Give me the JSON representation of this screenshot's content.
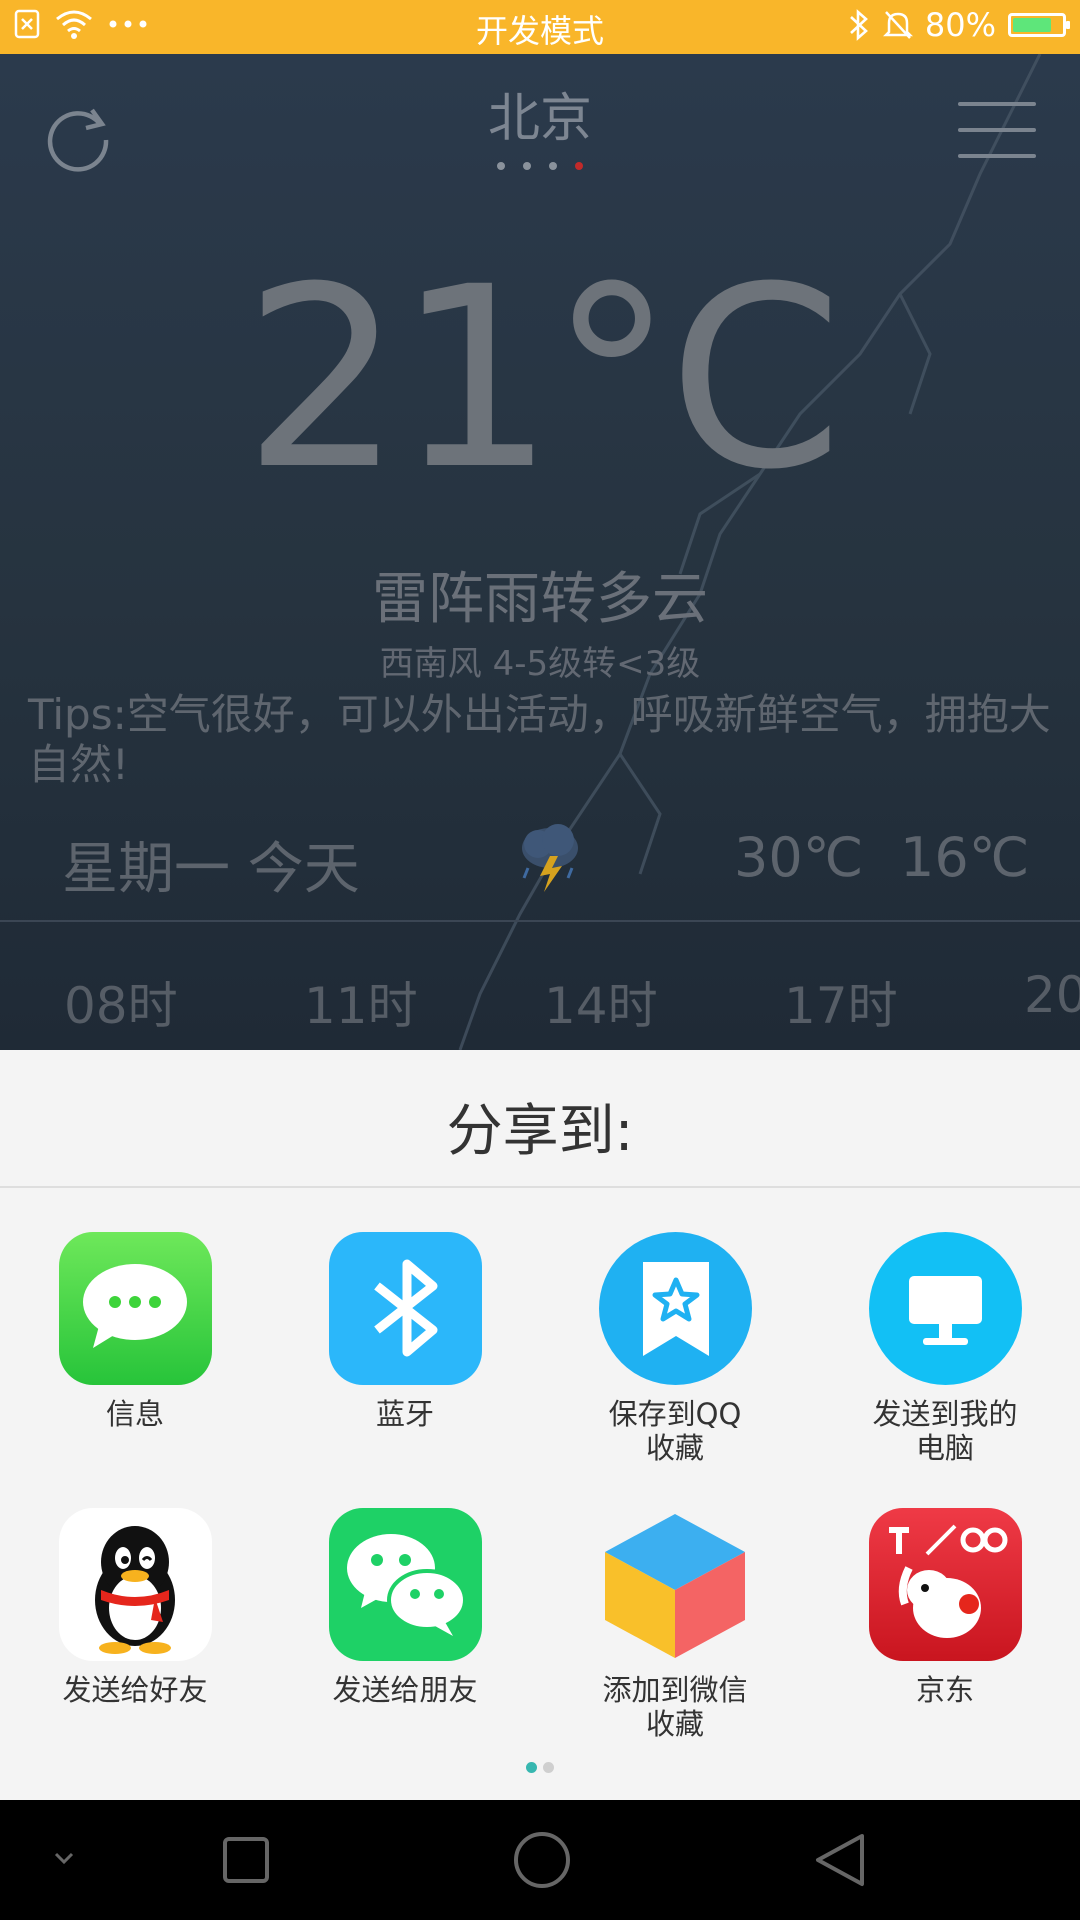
{
  "status_bar": {
    "title": "开发模式",
    "battery": "80%",
    "battery_level": 0.8,
    "icons": [
      "sim-x-icon",
      "wifi-icon",
      "more-dots-icon",
      "bluetooth-icon",
      "mute-bell-icon",
      "battery-charging-icon"
    ]
  },
  "weather": {
    "city": "北京",
    "page_dots": 4,
    "active_dot": 3,
    "temperature": "21°C",
    "condition": "雷阵雨转多云",
    "wind": "西南风 4-5级转<3级",
    "tips": "Tips:空气很好，可以外出活动，呼吸新鲜空气，拥抱大自然!",
    "today": {
      "label": "星期一 今天",
      "icon": "thunderstorm-cloud-icon",
      "high": "30℃",
      "low": "16℃"
    },
    "hours": [
      "08时",
      "11时",
      "14时",
      "17时",
      "20"
    ]
  },
  "share": {
    "title": "分享到:",
    "items": [
      {
        "label": "信息",
        "icon": "messages-icon",
        "color": "#3fd43a"
      },
      {
        "label": "蓝牙",
        "icon": "bluetooth-icon",
        "color": "#2bb7fa"
      },
      {
        "label": "保存到QQ收藏",
        "icon": "qq-favorites-icon",
        "color": "#1fb1f2"
      },
      {
        "label": "发送到我的电脑",
        "icon": "computer-icon",
        "color": "#12c0f5"
      },
      {
        "label": "发送给好友",
        "icon": "qq-penguin-icon",
        "color": "#ffffff"
      },
      {
        "label": "发送给朋友",
        "icon": "wechat-icon",
        "color": "#1ed166"
      },
      {
        "label": "添加到微信收藏",
        "icon": "wechat-favorites-cube-icon",
        "color": "#f9c02a"
      },
      {
        "label": "京东",
        "icon": "jd-icon",
        "color": "#e0262c"
      }
    ],
    "pages": 2,
    "active_page": 0
  },
  "nav_bar": {
    "icons": [
      "collapse-chevron-icon",
      "recents-square-icon",
      "home-circle-icon",
      "back-triangle-icon"
    ]
  }
}
